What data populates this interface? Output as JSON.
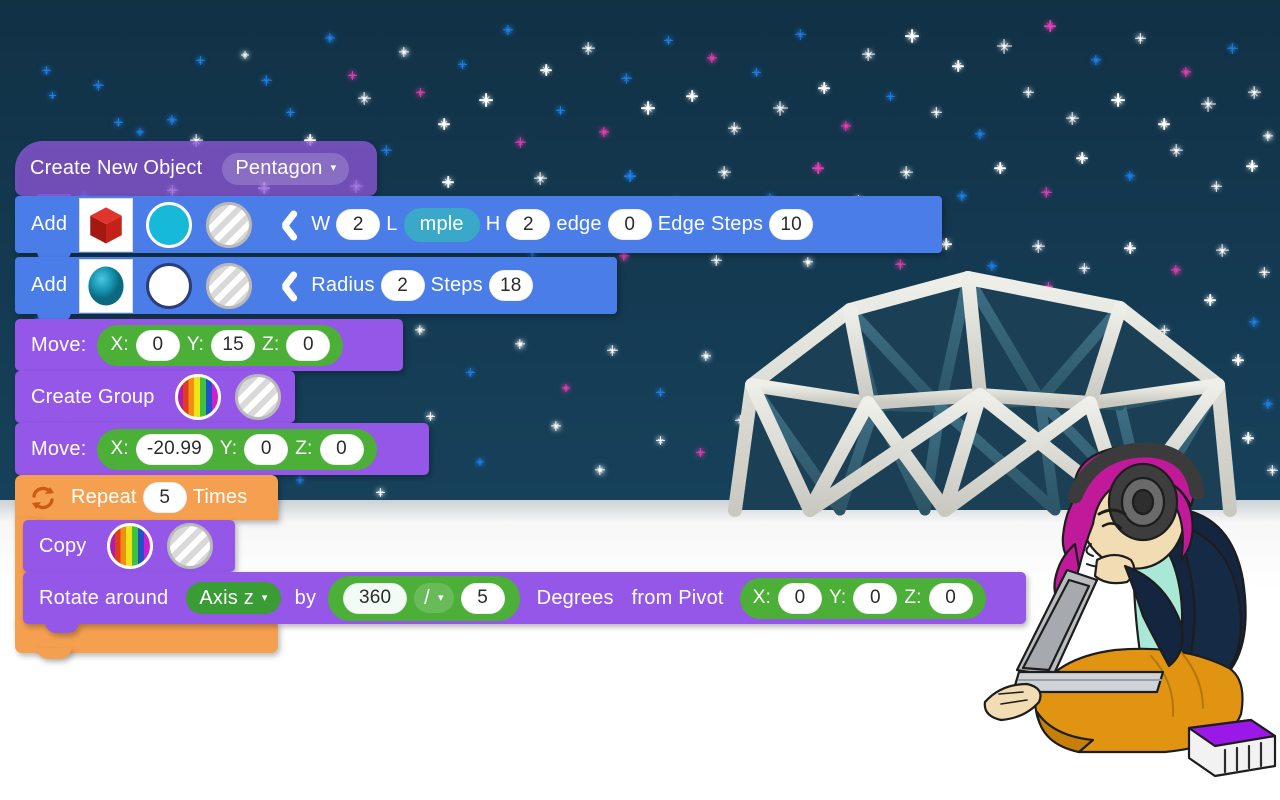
{
  "app": {
    "background_sky_color": "#143a52",
    "ground_color": "#ffffff"
  },
  "scene": {
    "dome_name": "geodesic-dome-illustration",
    "person_name": "person-with-laptop-illustration",
    "star_color_blue": "#1f7fe8",
    "star_color_pink": "#e63fb0",
    "star_color_white": "#ffffff"
  },
  "script": {
    "blocks": [
      {
        "id": "create-new-object",
        "type": "hat",
        "color": "#965ce5",
        "label": "Create New Object",
        "dropdown_value": "Pentagon",
        "caret": "▾"
      },
      {
        "id": "add-cube",
        "type": "stack",
        "color": "#4a7de8",
        "label": "Add",
        "thumbnail": "red-cube-thumbnail",
        "color_swatch": "cyan",
        "texture_swatch": "striped",
        "chevron": "collapse-chevron-icon",
        "fields": [
          {
            "label": "W",
            "value": "2"
          },
          {
            "label": "L",
            "value": "mple",
            "highlighted": true
          },
          {
            "label": "H",
            "value": "2"
          },
          {
            "label": "edge",
            "value": "0"
          },
          {
            "label": "Edge Steps",
            "value": "10"
          }
        ]
      },
      {
        "id": "add-sphere",
        "type": "stack",
        "color": "#4a7de8",
        "label": "Add",
        "thumbnail": "blue-sphere-thumbnail",
        "color_swatch": "white",
        "texture_swatch": "striped",
        "chevron": "collapse-chevron-icon",
        "fields": [
          {
            "label": "Radius",
            "value": "2"
          },
          {
            "label": "Steps",
            "value": "18"
          }
        ]
      },
      {
        "id": "move-1",
        "type": "stack",
        "color": "#9457e8",
        "label": "Move:",
        "coords": [
          {
            "axis": "X:",
            "value": "0"
          },
          {
            "axis": "Y:",
            "value": "15"
          },
          {
            "axis": "Z:",
            "value": "0"
          }
        ]
      },
      {
        "id": "create-group",
        "type": "stack",
        "color": "#9457e8",
        "label": "Create Group",
        "color_swatch": "rainbow",
        "texture_swatch": "striped"
      },
      {
        "id": "move-2",
        "type": "stack",
        "color": "#9457e8",
        "label": "Move:",
        "coords": [
          {
            "axis": "X:",
            "value": "-20.99"
          },
          {
            "axis": "Y:",
            "value": "0"
          },
          {
            "axis": "Z:",
            "value": "0"
          }
        ]
      },
      {
        "id": "repeat",
        "type": "c-block",
        "color": "#f5a050",
        "icon": "loop-icon",
        "label_before": "Repeat",
        "value": "5",
        "label_after": "Times"
      },
      {
        "id": "copy",
        "type": "stack",
        "color": "#9457e8",
        "label": "Copy",
        "color_swatch": "rainbow",
        "texture_swatch": "striped"
      },
      {
        "id": "rotate-around",
        "type": "stack",
        "color": "#9457e8",
        "label": "Rotate around",
        "axis_dropdown": "Axis z",
        "caret": "▾",
        "label_by": "by",
        "expr_left": "360",
        "operator": "/",
        "operator_caret": "▾",
        "expr_right": "5",
        "label_degrees": "Degrees",
        "label_from_pivot": "from Pivot",
        "pivot": [
          {
            "axis": "X:",
            "value": "0"
          },
          {
            "axis": "Y:",
            "value": "0"
          },
          {
            "axis": "Z:",
            "value": "0"
          }
        ]
      }
    ]
  }
}
